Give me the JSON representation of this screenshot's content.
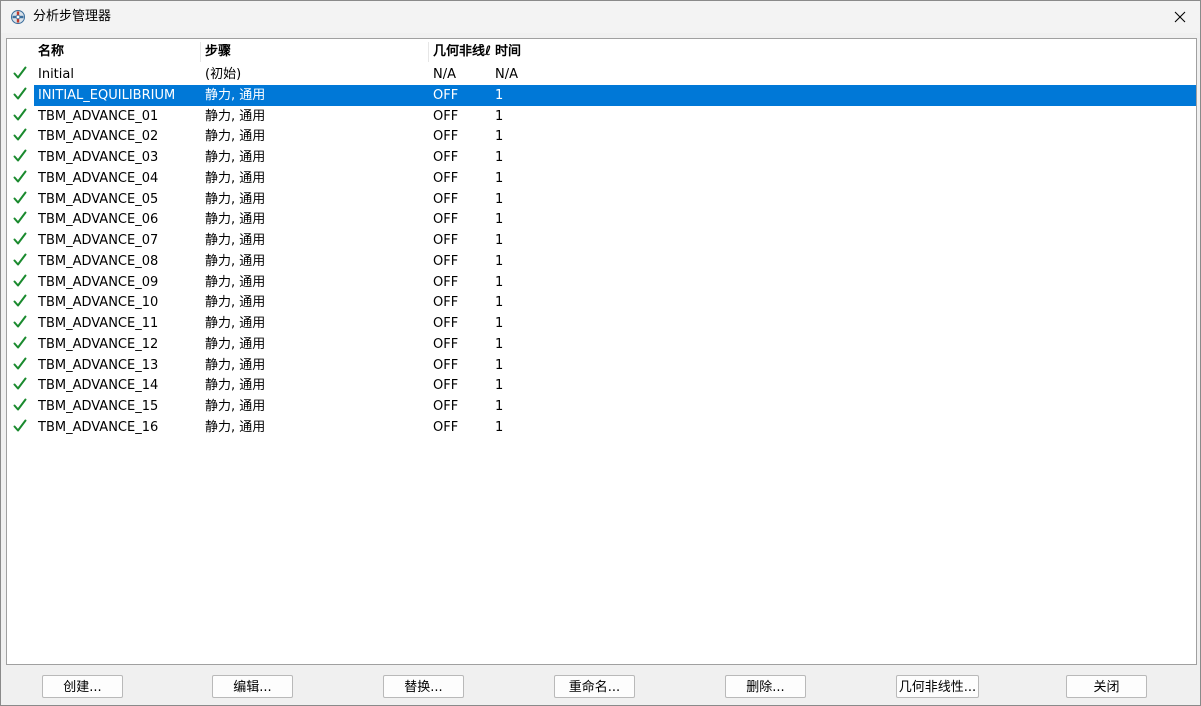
{
  "window": {
    "title": "分析步管理器"
  },
  "table": {
    "columns": {
      "name": "名称",
      "procedure": "步骤",
      "nlgeom": "几何非线ℓ",
      "time": "时间"
    },
    "rows": [
      {
        "name": "Initial",
        "procedure": "(初始)",
        "nlgeom": "N/A",
        "time": "N/A"
      },
      {
        "name": "INITIAL_EQUILIBRIUM",
        "procedure": "静力, 通用",
        "nlgeom": "OFF",
        "time": "1"
      },
      {
        "name": "TBM_ADVANCE_01",
        "procedure": "静力, 通用",
        "nlgeom": "OFF",
        "time": "1"
      },
      {
        "name": "TBM_ADVANCE_02",
        "procedure": "静力, 通用",
        "nlgeom": "OFF",
        "time": "1"
      },
      {
        "name": "TBM_ADVANCE_03",
        "procedure": "静力, 通用",
        "nlgeom": "OFF",
        "time": "1"
      },
      {
        "name": "TBM_ADVANCE_04",
        "procedure": "静力, 通用",
        "nlgeom": "OFF",
        "time": "1"
      },
      {
        "name": "TBM_ADVANCE_05",
        "procedure": "静力, 通用",
        "nlgeom": "OFF",
        "time": "1"
      },
      {
        "name": "TBM_ADVANCE_06",
        "procedure": "静力, 通用",
        "nlgeom": "OFF",
        "time": "1"
      },
      {
        "name": "TBM_ADVANCE_07",
        "procedure": "静力, 通用",
        "nlgeom": "OFF",
        "time": "1"
      },
      {
        "name": "TBM_ADVANCE_08",
        "procedure": "静力, 通用",
        "nlgeom": "OFF",
        "time": "1"
      },
      {
        "name": "TBM_ADVANCE_09",
        "procedure": "静力, 通用",
        "nlgeom": "OFF",
        "time": "1"
      },
      {
        "name": "TBM_ADVANCE_10",
        "procedure": "静力, 通用",
        "nlgeom": "OFF",
        "time": "1"
      },
      {
        "name": "TBM_ADVANCE_11",
        "procedure": "静力, 通用",
        "nlgeom": "OFF",
        "time": "1"
      },
      {
        "name": "TBM_ADVANCE_12",
        "procedure": "静力, 通用",
        "nlgeom": "OFF",
        "time": "1"
      },
      {
        "name": "TBM_ADVANCE_13",
        "procedure": "静力, 通用",
        "nlgeom": "OFF",
        "time": "1"
      },
      {
        "name": "TBM_ADVANCE_14",
        "procedure": "静力, 通用",
        "nlgeom": "OFF",
        "time": "1"
      },
      {
        "name": "TBM_ADVANCE_15",
        "procedure": "静力, 通用",
        "nlgeom": "OFF",
        "time": "1"
      },
      {
        "name": "TBM_ADVANCE_16",
        "procedure": "静力, 通用",
        "nlgeom": "OFF",
        "time": "1"
      }
    ],
    "selected_index": 1
  },
  "buttons": {
    "create": "创建...",
    "edit": "编辑...",
    "replace": "替换...",
    "rename": "重命名...",
    "delete": "删除...",
    "nlgeom": "几何非线性...",
    "close": "关闭"
  },
  "colors": {
    "selection": "#0078d7",
    "check": "#1a8a2e"
  },
  "icons": {
    "title": "steps-manager-icon",
    "close": "close-icon",
    "row_status": "checkmark-icon"
  }
}
